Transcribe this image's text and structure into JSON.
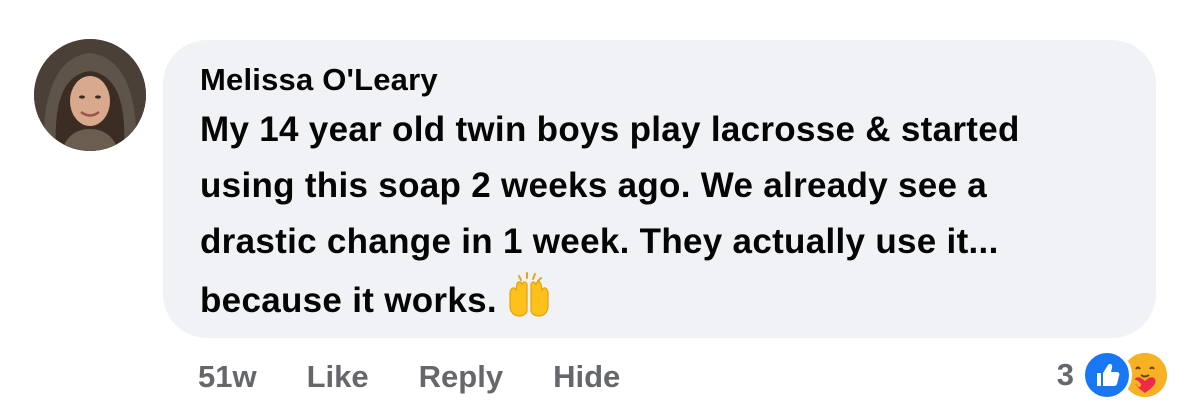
{
  "comment": {
    "author": "Melissa O'Leary",
    "text_lines": [
      "My 14 year old twin boys play lacrosse & started",
      "using this soap 2 weeks ago. We already see a",
      "drastic change in 1 week. They actually use it...",
      "because it works."
    ],
    "emoji": "raising-hands-icon",
    "avatar_icon": "profile-photo"
  },
  "actions": {
    "timestamp": "51w",
    "like_label": "Like",
    "reply_label": "Reply",
    "hide_label": "Hide"
  },
  "reactions": {
    "count": "3",
    "icons": [
      "like-reaction-icon",
      "care-reaction-icon"
    ]
  },
  "colors": {
    "bubble_bg": "#f0f2f5",
    "text": "#050505",
    "secondary_text": "#65676b",
    "like_blue": "#1877f2",
    "care_yellow": "#f7b125"
  }
}
